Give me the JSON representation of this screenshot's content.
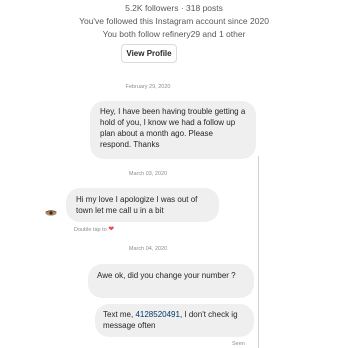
{
  "profile": {
    "stats": "5.2K followers · 318 posts",
    "followed_since": "You've followed this Instagram account since 2020",
    "mutuals": "You both follow refinery29 and 1 other",
    "view_profile_label": "View Profile"
  },
  "messages": [
    {
      "date": "February 29, 2020",
      "sender": "me",
      "text": "Hey, I have been having trouble getting a hold of you, I know we had a follow up plan about a month ago. Please respond.  Thanks"
    },
    {
      "date": "March 03, 2020",
      "sender": "them",
      "text": "Hi my love I apologize I was out of town let me call u in a bit",
      "reaction_hint": "Double tap to"
    },
    {
      "date": "March 04, 2020",
      "sender": "me",
      "text": "Awe ok, did you change your number ?"
    },
    {
      "sender": "me",
      "text_before": "Text me, ",
      "phone": "4128520491",
      "text_after": ", I don't check ig message often"
    }
  ],
  "seen_label": "Seen",
  "colors": {
    "bubble": "#efefef",
    "link": "#00376b",
    "heart": "#ed4956",
    "meta_text": "#8e8e8e"
  },
  "icons": [
    "avatar-icon",
    "heart-icon"
  ]
}
